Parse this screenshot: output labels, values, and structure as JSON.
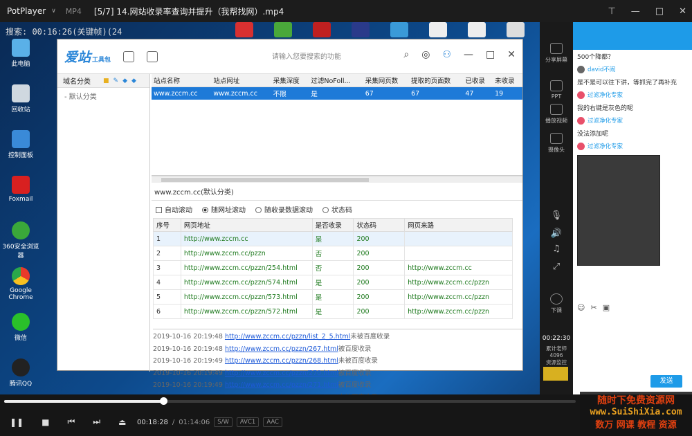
{
  "player": {
    "app_name": "PotPlayer",
    "caret": "∨",
    "format": "MP4",
    "file_title": "[5/7] 14.网站收录率查询并提升（我帮找网）.mp4",
    "controls_glyphs": {
      "pin": "⊤",
      "minimize": "—",
      "maximize": "□",
      "close": "✕"
    }
  },
  "recording_overlay": "搜索: 00:16:26(关键帧)(24",
  "desktop_icons": [
    {
      "label": "此电脑"
    },
    {
      "label": "回收站"
    },
    {
      "label": "控制面板"
    },
    {
      "label": "Foxmail"
    },
    {
      "label": "360安全浏览器"
    },
    {
      "label": "Google Chrome"
    },
    {
      "label": "微信"
    },
    {
      "label": "腾讯QQ"
    }
  ],
  "aizhan": {
    "logo": "爱站",
    "logo_sub": "工具包",
    "search_placeholder": "请输入您要搜索的功能",
    "sidebar": {
      "header": "域名分类",
      "items": [
        "默认分类"
      ]
    },
    "site_table": {
      "headers": [
        "站点名称",
        "站点网址",
        "采集深度",
        "过滤NoFoll...",
        "采集网页数",
        "提取的页面数",
        "已收录",
        "未收录"
      ],
      "rows": [
        [
          "www.zccm.cc",
          "www.zccm.cc",
          "不限",
          "是",
          "67",
          "67",
          "47",
          "19"
        ]
      ]
    },
    "detail_title": "www.zccm.cc(默认分类)",
    "options": {
      "auto_scroll": "自动滚动",
      "r1": "随网址滚动",
      "r2": "随收录数据滚动",
      "r3": "状态码"
    },
    "url_table": {
      "headers": [
        "序号",
        "网页地址",
        "是否收录",
        "状态码",
        "网页来路"
      ],
      "rows": [
        [
          "1",
          "http://www.zccm.cc",
          "是",
          "200",
          ""
        ],
        [
          "2",
          "http://www.zccm.cc/pzzn",
          "否",
          "200",
          ""
        ],
        [
          "3",
          "http://www.zccm.cc/pzzn/254.html",
          "否",
          "200",
          "http://www.zccm.cc"
        ],
        [
          "4",
          "http://www.zccm.cc/pzzn/574.html",
          "是",
          "200",
          "http://www.zccm.cc/pzzn"
        ],
        [
          "5",
          "http://www.zccm.cc/pzzn/573.html",
          "是",
          "200",
          "http://www.zccm.cc/pzzn"
        ],
        [
          "6",
          "http://www.zccm.cc/pzzn/572.html",
          "是",
          "200",
          "http://www.zccm.cc/pzzn"
        ]
      ]
    },
    "log": [
      {
        "time": "2019-10-16 20:19:48",
        "url": "http://www.zccm.cc/pzzn/list_2_5.html",
        "msg": "未被百度收录"
      },
      {
        "time": "2019-10-16 20:19:48",
        "url": "http://www.zccm.cc/pzzn/267.html",
        "msg": "被百度收录"
      },
      {
        "time": "2019-10-16 20:19:49",
        "url": "http://www.zccm.cc/pzzn/268.html",
        "msg": "未被百度收录"
      },
      {
        "time": "2019-10-16 20:19:49",
        "url": "http://www.zccm.cc/pzzn/270.html",
        "msg": "被百度收录"
      },
      {
        "time": "2019-10-16 20:19:49",
        "url": "http://www.zccm.cc/pzzn/271.html",
        "msg": "被百度收录"
      },
      {
        "time": "2019-10-16 20:19:50",
        "url": "http://www.zccm.cc/pzzn/260.html",
        "msg": "未被百度收录"
      },
      {
        "time": "2019-10-16 20:19:50",
        "url": "http://www.zccm.cc/pzzn/273.html",
        "msg": "未被百度收录"
      }
    ]
  },
  "qq": {
    "strip": {
      "share_screen": "分享屏幕",
      "ppt": "PPT",
      "video": "播放视频",
      "camera": "摄像头",
      "end_class": "下课",
      "time": "00:22:30",
      "count_label": "累计老师",
      "count": "4096",
      "status": "资源监控"
    },
    "messages": [
      {
        "type": "msg",
        "text": "500个降都？"
      },
      {
        "type": "name",
        "text": "david不闹",
        "avatar": "gray"
      },
      {
        "type": "msg",
        "text": "是不是可以往下讲，等抓完了再补充"
      },
      {
        "type": "name",
        "text": "过滤净化专家",
        "avatar": "red"
      },
      {
        "type": "msg",
        "text": "我的右键是灰色的呢"
      },
      {
        "type": "name",
        "text": "过滤净化专家",
        "avatar": "red"
      },
      {
        "type": "msg",
        "text": "没法添加呢"
      },
      {
        "type": "name",
        "text": "过滤净化专家",
        "avatar": "red"
      }
    ],
    "send_label": "发送"
  },
  "playback": {
    "current": "00:18:28",
    "separator": "/",
    "duration": "01:14:06",
    "tags": [
      "S/W",
      "AVC1",
      "AAC"
    ],
    "progress": 0.2786
  },
  "watermark": {
    "line1": "随时下免费资源网",
    "line2": "www.SuiShiXia.com",
    "line3": "数万 网课 教程 资源"
  },
  "colors": {
    "accent_blue": "#1e7ad8",
    "qq_blue": "#1e9be8",
    "link_green": "#1e7a1e",
    "watermark_red": "#e04010"
  }
}
